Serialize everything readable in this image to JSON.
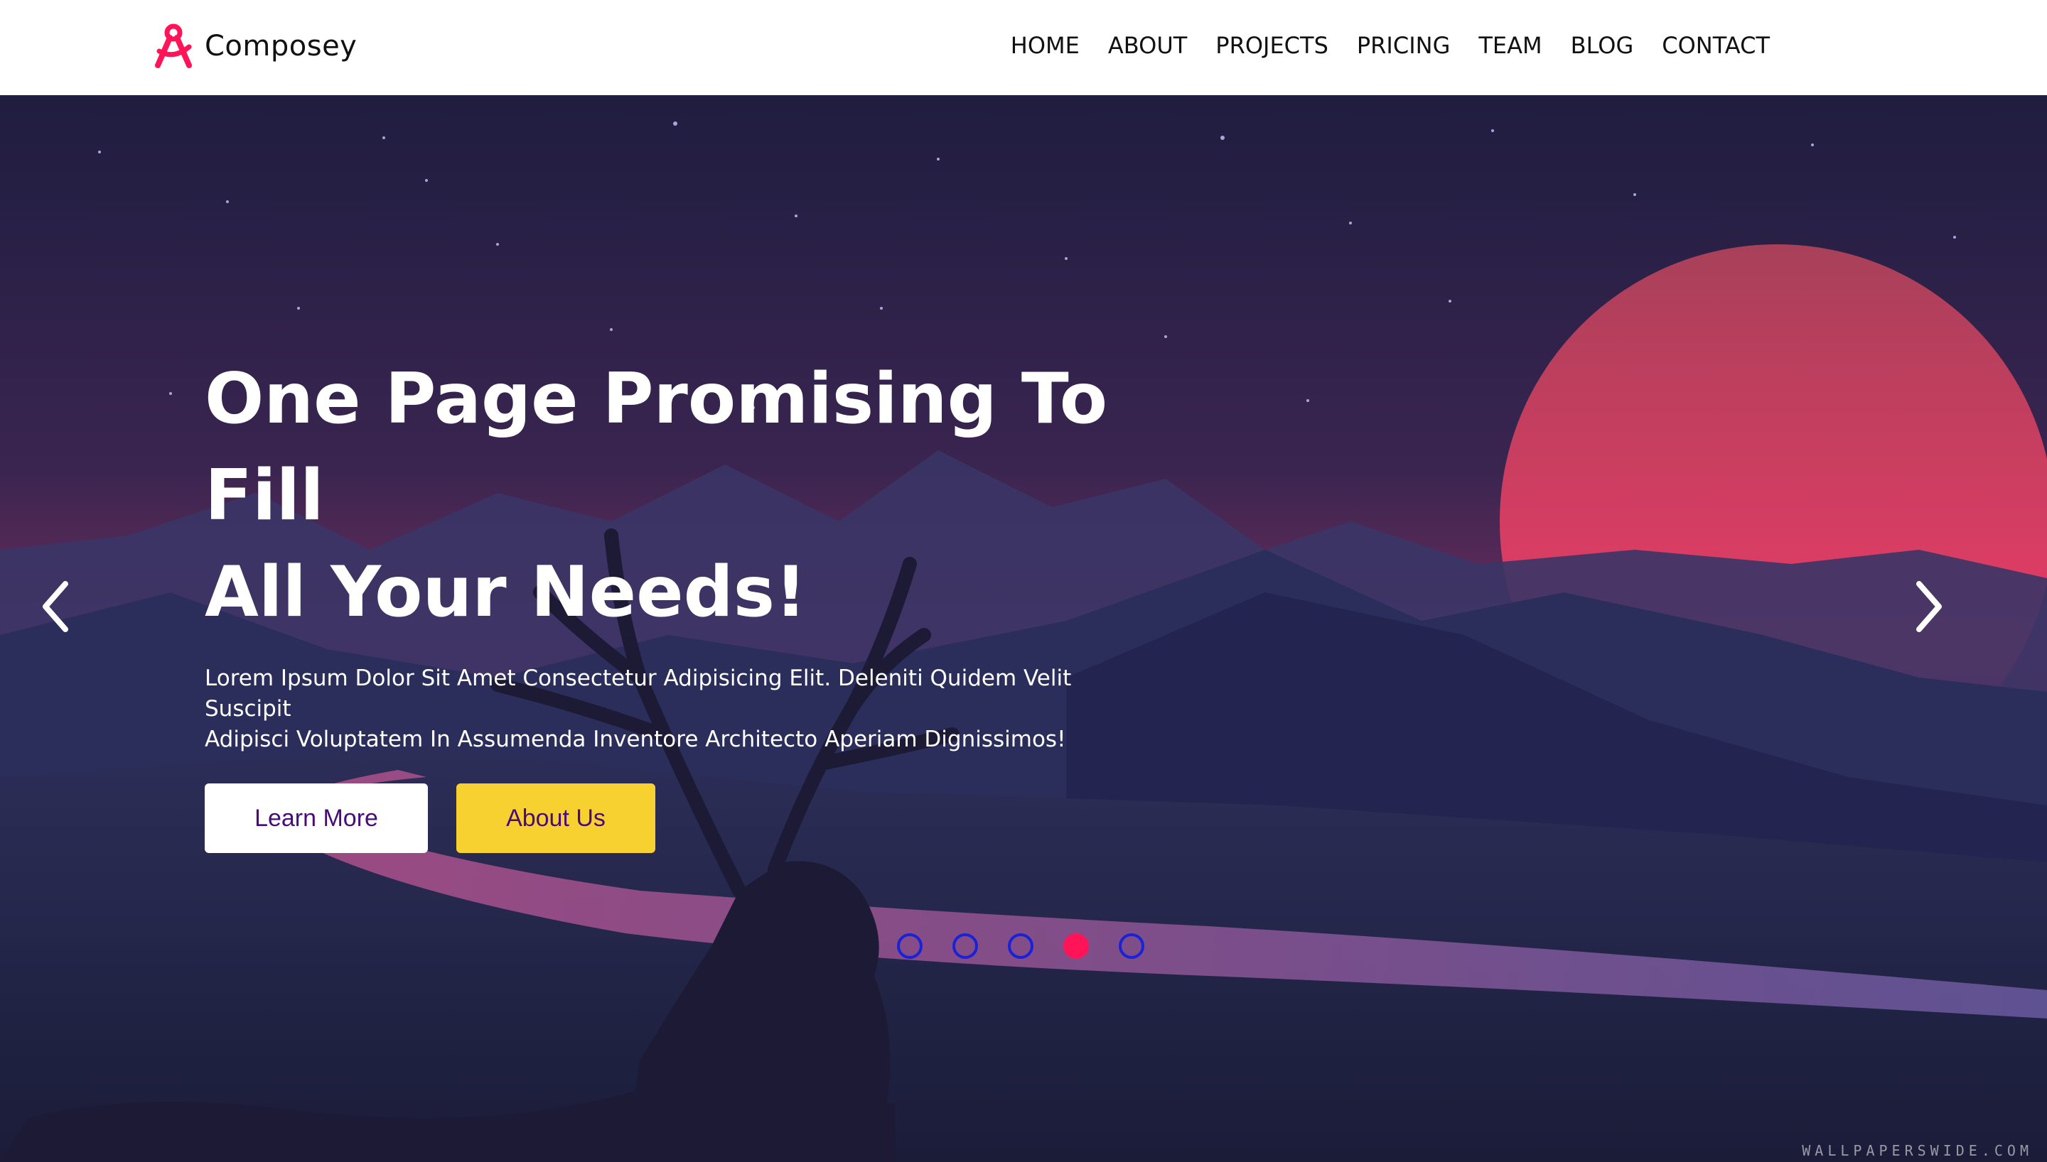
{
  "header": {
    "brand": "Composey",
    "nav": [
      "HOME",
      "ABOUT",
      "PROJECTS",
      "PRICING",
      "TEAM",
      "BLOG",
      "CONTACT"
    ]
  },
  "hero": {
    "title_line1": "One Page Promising To Fill",
    "title_line2": "All Your Needs!",
    "text_line1": "Lorem Ipsum Dolor Sit Amet Consectetur Adipisicing Elit. Deleniti Quidem Velit Suscipit",
    "text_line2": "Adipisci Voluptatem In Assumenda Inventore Architecto Aperiam Dignissimos!",
    "learn_more": "Learn More",
    "about_us": "About Us",
    "slide_count": 5,
    "active_slide": 4,
    "watermark": "WALLPAPERSWIDE.COM"
  },
  "colors": {
    "accent": "#ff1458",
    "button_yellow": "#f6d12f",
    "button_text": "#4a0a7a",
    "dot_border": "#1a22d8"
  },
  "icons": {
    "logo": "compass-logo-icon",
    "prev": "chevron-left-icon",
    "next": "chevron-right-icon"
  }
}
